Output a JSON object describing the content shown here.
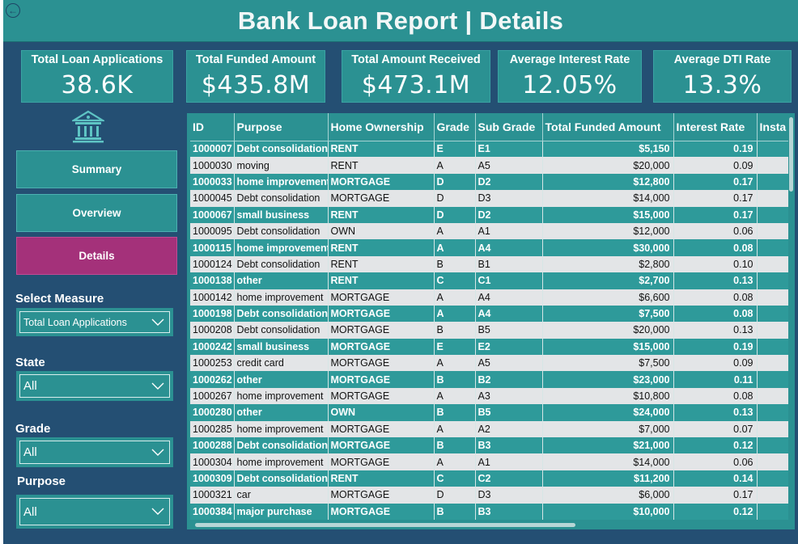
{
  "header": {
    "title": "Bank Loan Report | Details"
  },
  "kpis": [
    {
      "title": "Total Loan Applications",
      "value": "38.6K"
    },
    {
      "title": "Total Funded Amount",
      "value": "$435.8M"
    },
    {
      "title": "Total Amount Received",
      "value": "$473.1M"
    },
    {
      "title": "Average Interest Rate",
      "value": "12.05%"
    },
    {
      "title": "Average DTI Rate",
      "value": "13.3%"
    }
  ],
  "nav": {
    "summary": "Summary",
    "overview": "Overview",
    "details": "Details"
  },
  "slicers": {
    "measure": {
      "label": "Select Measure",
      "value": "Total Loan Applications"
    },
    "state": {
      "label": "State",
      "value": "All"
    },
    "grade": {
      "label": "Grade",
      "value": "All"
    },
    "purpose": {
      "label": "Purpose",
      "value": "All"
    }
  },
  "table": {
    "columns": [
      "ID",
      "Purpose",
      "Home Ownership",
      "Grade",
      "Sub Grade",
      "Total Funded Amount",
      "Interest Rate",
      "Insta"
    ],
    "rows": [
      [
        "1000007",
        "Debt consolidation",
        "RENT",
        "E",
        "E1",
        "$5,150",
        "0.19",
        ""
      ],
      [
        "1000030",
        "moving",
        "RENT",
        "A",
        "A5",
        "$20,000",
        "0.09",
        ""
      ],
      [
        "1000033",
        "home improvement",
        "MORTGAGE",
        "D",
        "D2",
        "$12,800",
        "0.17",
        ""
      ],
      [
        "1000045",
        "Debt consolidation",
        "MORTGAGE",
        "D",
        "D3",
        "$14,000",
        "0.17",
        ""
      ],
      [
        "1000067",
        "small business",
        "RENT",
        "D",
        "D2",
        "$15,000",
        "0.17",
        ""
      ],
      [
        "1000095",
        "Debt consolidation",
        "OWN",
        "A",
        "A1",
        "$12,000",
        "0.06",
        ""
      ],
      [
        "1000115",
        "home improvement",
        "RENT",
        "A",
        "A4",
        "$30,000",
        "0.08",
        ""
      ],
      [
        "1000124",
        "Debt consolidation",
        "RENT",
        "B",
        "B1",
        "$2,800",
        "0.10",
        ""
      ],
      [
        "1000138",
        "other",
        "RENT",
        "C",
        "C1",
        "$2,700",
        "0.13",
        ""
      ],
      [
        "1000142",
        "home improvement",
        "MORTGAGE",
        "A",
        "A4",
        "$6,600",
        "0.08",
        ""
      ],
      [
        "1000198",
        "Debt consolidation",
        "MORTGAGE",
        "A",
        "A4",
        "$7,500",
        "0.08",
        ""
      ],
      [
        "1000208",
        "Debt consolidation",
        "MORTGAGE",
        "B",
        "B5",
        "$20,000",
        "0.13",
        ""
      ],
      [
        "1000242",
        "small business",
        "MORTGAGE",
        "E",
        "E2",
        "$15,000",
        "0.19",
        ""
      ],
      [
        "1000253",
        "credit card",
        "MORTGAGE",
        "A",
        "A5",
        "$7,500",
        "0.09",
        ""
      ],
      [
        "1000262",
        "other",
        "MORTGAGE",
        "B",
        "B2",
        "$23,000",
        "0.11",
        ""
      ],
      [
        "1000267",
        "home improvement",
        "MORTGAGE",
        "A",
        "A3",
        "$10,800",
        "0.08",
        ""
      ],
      [
        "1000280",
        "other",
        "OWN",
        "B",
        "B5",
        "$24,000",
        "0.13",
        ""
      ],
      [
        "1000285",
        "home improvement",
        "MORTGAGE",
        "A",
        "A2",
        "$7,000",
        "0.07",
        ""
      ],
      [
        "1000288",
        "Debt consolidation",
        "MORTGAGE",
        "B",
        "B3",
        "$21,000",
        "0.12",
        ""
      ],
      [
        "1000304",
        "home improvement",
        "MORTGAGE",
        "A",
        "A1",
        "$14,000",
        "0.06",
        ""
      ],
      [
        "1000309",
        "Debt consolidation",
        "RENT",
        "C",
        "C2",
        "$11,200",
        "0.14",
        ""
      ],
      [
        "1000321",
        "car",
        "MORTGAGE",
        "D",
        "D3",
        "$6,000",
        "0.17",
        ""
      ],
      [
        "1000384",
        "major purchase",
        "MORTGAGE",
        "B",
        "B3",
        "$10,000",
        "0.12",
        ""
      ]
    ]
  },
  "colors": {
    "background": "#244f73",
    "teal": "#2b9192",
    "active_nav": "#a4317a",
    "row_grey": "#e3e5e7"
  },
  "icons": {
    "back": "back-arrow-icon",
    "logo": "bank-icon",
    "dropdown": "chevron-down-icon"
  }
}
